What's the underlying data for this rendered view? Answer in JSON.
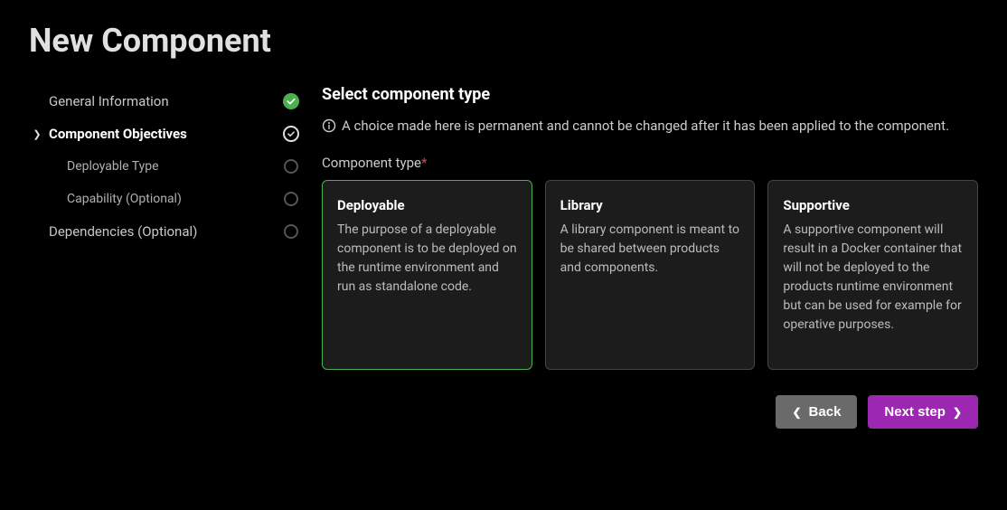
{
  "page_title": "New Component",
  "sidebar": {
    "steps": [
      {
        "label": "General Information",
        "status": "done",
        "active": false,
        "sub": false
      },
      {
        "label": "Component Objectives",
        "status": "ring-check",
        "active": true,
        "sub": false
      },
      {
        "label": "Deployable Type",
        "status": "empty",
        "active": false,
        "sub": true
      },
      {
        "label": "Capability (Optional)",
        "status": "empty",
        "active": false,
        "sub": true
      },
      {
        "label": "Dependencies (Optional)",
        "status": "empty",
        "active": false,
        "sub": false
      }
    ]
  },
  "main": {
    "heading": "Select component type",
    "info_text": "A choice made here is permanent and cannot be changed after it has been applied to the component.",
    "field_label": "Component type",
    "options": [
      {
        "title": "Deployable",
        "desc": "The purpose of a deployable component is to be deployed on the runtime environment and run as standalone code.",
        "selected": true
      },
      {
        "title": "Library",
        "desc": "A library component is meant to be shared between products and components.",
        "selected": false
      },
      {
        "title": "Supportive",
        "desc": "A supportive component will result in a Docker container that will not be deployed to the products runtime environment but can be used for example for operative purposes.",
        "selected": false
      }
    ]
  },
  "footer": {
    "back_label": "Back",
    "next_label": "Next step"
  }
}
